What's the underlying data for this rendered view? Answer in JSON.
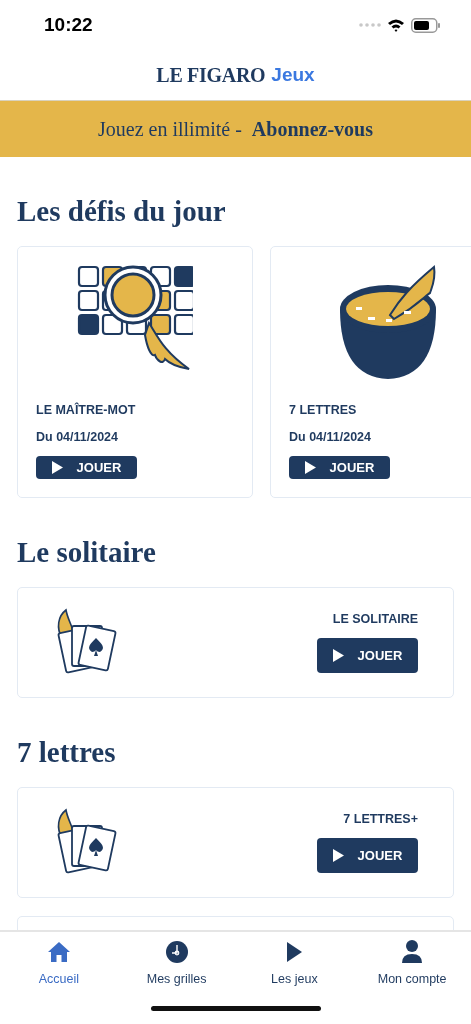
{
  "status_bar": {
    "time": "10:22"
  },
  "header": {
    "logo": "LE FIGARO",
    "logo_suffix": "Jeux"
  },
  "banner": {
    "text": "Jouez en illimité -",
    "link": "Abonnez-vous"
  },
  "sections": [
    {
      "title": "Les défis du jour",
      "kind": "carousel",
      "cards": [
        {
          "kind": "grid",
          "title": "LE MAÎTRE-MOT",
          "date": "Du 04/11/2024",
          "button": "JOUER"
        },
        {
          "kind": "bowl",
          "title": "7 LETTRES",
          "date": "Du 04/11/2024",
          "button": "JOUER"
        }
      ]
    },
    {
      "title": "Le solitaire",
      "kind": "list",
      "cards": [
        {
          "kind": "cards",
          "title": "LE SOLITAIRE",
          "button": "JOUER"
        }
      ]
    },
    {
      "title": "7 lettres",
      "kind": "list",
      "cards": [
        {
          "kind": "cards",
          "title": "7 LETTRES+",
          "button": "JOUER"
        },
        {
          "kind": "partial"
        }
      ]
    }
  ],
  "nav": [
    {
      "kind": "home",
      "label": "Accueil",
      "selected": true
    },
    {
      "kind": "clock",
      "label": "Mes grilles",
      "selected": false
    },
    {
      "kind": "play",
      "label": "Les jeux",
      "selected": false
    },
    {
      "kind": "person",
      "label": "Mon compte",
      "selected": false
    }
  ]
}
